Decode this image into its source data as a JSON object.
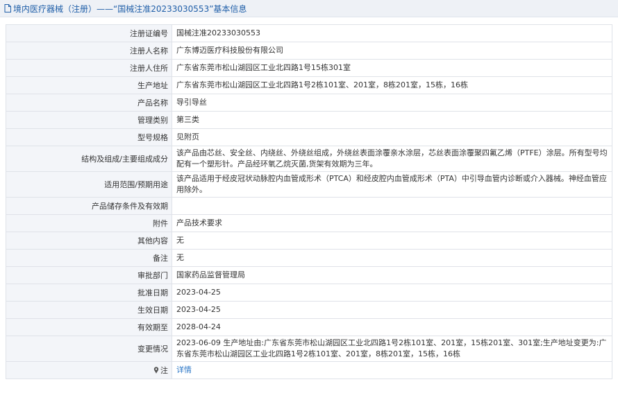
{
  "header": {
    "title": "境内医疗器械（注册）——“国械注准20233030553”基本信息"
  },
  "rows": [
    {
      "label": "注册证编号",
      "value": "国械注准20233030553"
    },
    {
      "label": "注册人名称",
      "value": "广东博迈医疗科技股份有限公司"
    },
    {
      "label": "注册人住所",
      "value": "广东省东莞市松山湖园区工业北四路1号15栋301室"
    },
    {
      "label": "生产地址",
      "value": "广东省东莞市松山湖园区工业北四路1号2栋101室、201室，8栋201室，15栋，16栋"
    },
    {
      "label": "产品名称",
      "value": "导引导丝"
    },
    {
      "label": "管理类别",
      "value": "第三类"
    },
    {
      "label": "型号规格",
      "value": "见附页"
    },
    {
      "label": "结构及组成/主要组成成分",
      "value": "该产品由芯丝、安全丝、内绕丝、外绕丝组成，外绕丝表面涂覆亲水涂层，芯丝表面涂覆聚四氟乙烯（PTFE）涂层。所有型号均配有一个塑形针。产品经环氧乙烷灭菌,货架有效期为三年。"
    },
    {
      "label": "适用范围/预期用途",
      "value": "该产品适用于经皮冠状动脉腔内血管成形术（PTCA）和经皮腔内血管成形术（PTA）中引导血管内诊断或介入器械。神经血管应用除外。"
    },
    {
      "label": "产品储存条件及有效期",
      "value": ""
    },
    {
      "label": "附件",
      "value": "产品技术要求"
    },
    {
      "label": "其他内容",
      "value": "无"
    },
    {
      "label": "备注",
      "value": "无"
    },
    {
      "label": "审批部门",
      "value": "国家药品监督管理局"
    },
    {
      "label": "批准日期",
      "value": "2023-04-25"
    },
    {
      "label": "生效日期",
      "value": "2023-04-25"
    },
    {
      "label": "有效期至",
      "value": "2028-04-24"
    },
    {
      "label": "变更情况",
      "value": "2023-06-09 生产地址由:广东省东莞市松山湖园区工业北四路1号2栋101室、201室，15栋201室、301室;生产地址变更为:广东省东莞市松山湖园区工业北四路1号2栋101室、201室，8栋201室，15栋，16栋"
    }
  ],
  "note_row": {
    "label": "注",
    "link": "详情",
    "icon": "pin-icon"
  },
  "colors": {
    "link": "#2a76c6",
    "header_text": "#1f5ea8",
    "label_bg": "#f3f5f9",
    "border": "#dfe2e8"
  }
}
